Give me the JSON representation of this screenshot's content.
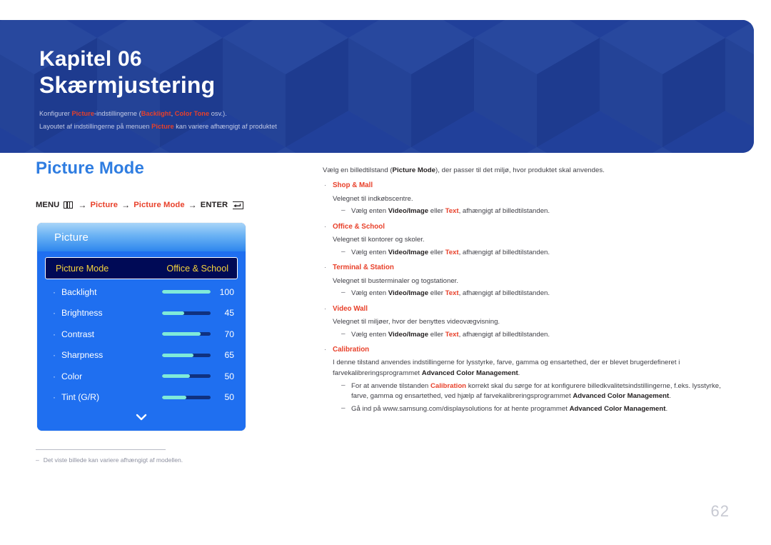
{
  "banner": {
    "chapter_number": "Kapitel 06",
    "chapter_title": "Skærmjustering",
    "sub1_a": "Konfigurer ",
    "sub1_hl1": "Picture",
    "sub1_b": "-indstillingerne (",
    "sub1_hl2": "Backlight",
    "sub1_c": ", ",
    "sub1_hl3": "Color Tone",
    "sub1_d": " osv.).",
    "sub2_a": "Layoutet af indstillingerne på menuen ",
    "sub2_hl1": "Picture",
    "sub2_b": " kan variere afhængigt af produktet",
    "bg_color": "#21409a",
    "accent_color": "#e8402a"
  },
  "left": {
    "section_title": "Picture Mode",
    "menu_path": {
      "menu_label": "MENU",
      "menu_icon": "menu-grid-icon",
      "arrow": "→",
      "step1": "Picture",
      "step2": "Picture Mode",
      "enter_label": "ENTER",
      "enter_icon": "enter-key-icon"
    },
    "osd": {
      "title": "Picture",
      "selected_row": {
        "label": "Picture Mode",
        "value": "Office & School"
      },
      "rows": [
        {
          "label": "Backlight",
          "value": "100",
          "fill_pct": 100
        },
        {
          "label": "Brightness",
          "value": "45",
          "fill_pct": 45
        },
        {
          "label": "Contrast",
          "value": "70",
          "fill_pct": 80
        },
        {
          "label": "Sharpness",
          "value": "65",
          "fill_pct": 65
        },
        {
          "label": "Color",
          "value": "50",
          "fill_pct": 57
        },
        {
          "label": "Tint (G/R)",
          "value": "50",
          "fill_pct": 50
        }
      ],
      "scroll_icon": "chevron-down-icon"
    },
    "footnote": {
      "dash": "‒",
      "text": "Det viste billede kan variere afhængigt af modellen."
    }
  },
  "right": {
    "intro_a": "Vælg en billedtilstand (",
    "intro_hl": "Picture Mode",
    "intro_b": "), der passer til det miljø, hvor produktet skal anvendes.",
    "bullet_mark": "·",
    "sub_mark": "‒",
    "items": [
      {
        "title": "Shop & Mall",
        "desc": "Velegnet til indkøbscentre.",
        "sub_a": "Vælg enten ",
        "sub_hl1": "Video/Image",
        "sub_b": " eller ",
        "sub_hl2": "Text",
        "sub_c": ", afhængigt af billedtilstanden."
      },
      {
        "title": "Office & School",
        "desc": "Velegnet til kontorer og skoler.",
        "sub_a": "Vælg enten ",
        "sub_hl1": "Video/Image",
        "sub_b": " eller ",
        "sub_hl2": "Text",
        "sub_c": ", afhængigt af billedtilstanden."
      },
      {
        "title": "Terminal & Station",
        "desc": "Velegnet til busterminaler og togstationer.",
        "sub_a": "Vælg enten ",
        "sub_hl1": "Video/Image",
        "sub_b": " eller ",
        "sub_hl2": "Text",
        "sub_c": ", afhængigt af billedtilstanden."
      },
      {
        "title": "Video Wall",
        "desc": "Velegnet til miljøer, hvor der benyttes videovægvisning.",
        "sub_a": "Vælg enten ",
        "sub_hl1": "Video/Image",
        "sub_b": " eller ",
        "sub_hl2": "Text",
        "sub_c": ", afhængigt af billedtilstanden."
      }
    ],
    "calibration": {
      "title": "Calibration",
      "desc_a": "I denne tilstand anvendes indstillingerne for lysstyrke, farve, gamma og ensartethed, der er blevet brugerdefineret i farvekalibreringsprogrammet ",
      "desc_bold": "Advanced Color Management",
      "desc_b": ".",
      "sub1_a": "For at anvende tilstanden ",
      "sub1_hl": "Calibration",
      "sub1_b": " korrekt skal du sørge for at konfigurere billedkvalitetsindstillingerne, f.eks. lysstyrke, farve, gamma og ensartethed, ved hjælp af farvekalibreringsprogrammet ",
      "sub1_bold": "Advanced Color Management",
      "sub1_c": ".",
      "sub2_a": "Gå ind på www.samsung.com/displaysolutions for at hente programmet ",
      "sub2_bold": "Advanced Color Management",
      "sub2_b": "."
    }
  },
  "page_number": "62"
}
